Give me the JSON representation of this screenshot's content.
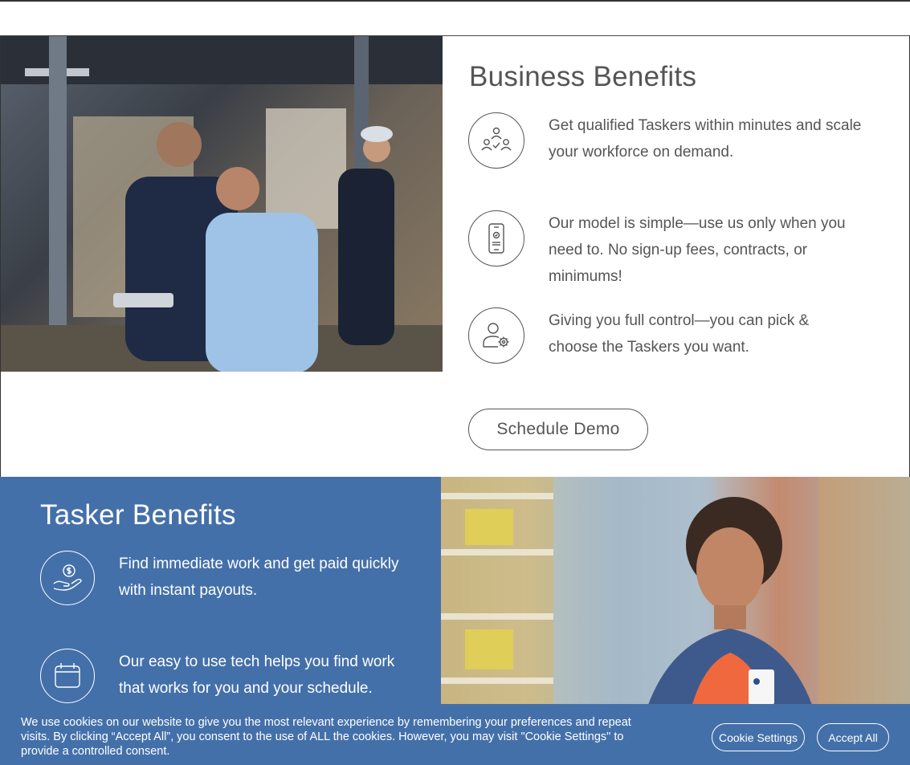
{
  "business": {
    "title": "Business Benefits",
    "benefits": [
      {
        "icon": "team-check-icon",
        "text": "Get qualified Taskers within minutes and scale your workforce on demand."
      },
      {
        "icon": "phone-check-icon",
        "text": "Our model is simple—use us only when you need to. No sign-up fees, contracts, or minimums!"
      },
      {
        "icon": "user-gear-icon",
        "text": "Giving you full control—you can pick & choose the Taskers you want."
      }
    ],
    "cta_label": "Schedule Demo"
  },
  "tasker": {
    "title": "Tasker Benefits",
    "benefits": [
      {
        "icon": "hand-dollar-icon",
        "text": "Find immediate work and get paid quickly with instant payouts."
      },
      {
        "icon": "calendar-icon",
        "text": "Our easy to use tech helps you find work that works for you and your schedule."
      }
    ]
  },
  "cookie": {
    "text": "We use cookies on our website to give you the most relevant experience by remembering your preferences and repeat visits. By clicking “Accept All”, you consent to the use of ALL the cookies. However, you may visit \"Cookie Settings\" to provide a controlled consent.",
    "settings_label": "Cookie Settings",
    "accept_label": "Accept All"
  },
  "colors": {
    "brand_blue": "#4470aa",
    "text_gray": "#555555"
  }
}
